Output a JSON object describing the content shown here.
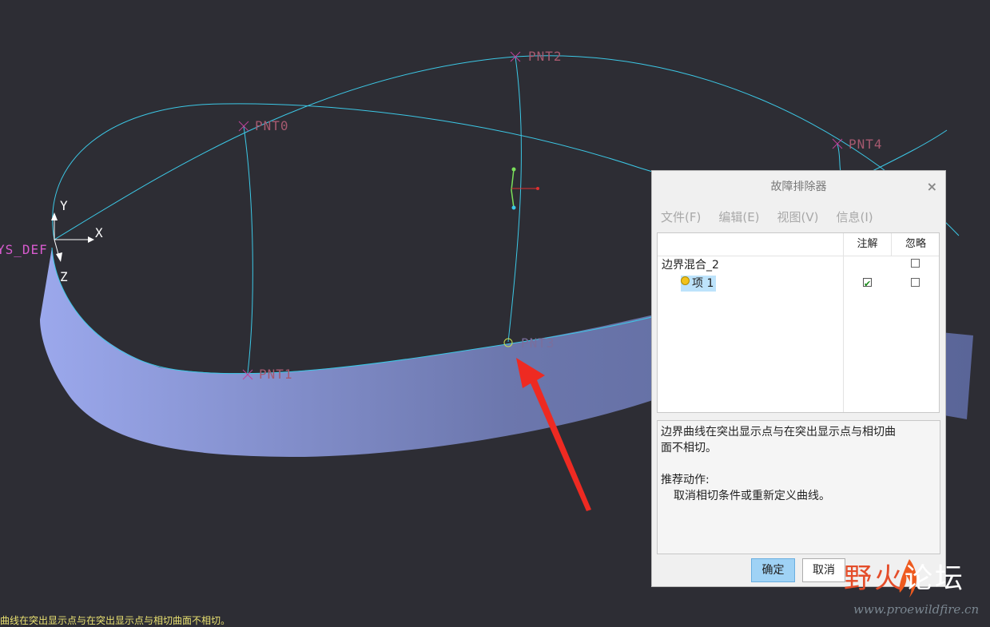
{
  "viewport": {
    "points": [
      "PNT0",
      "PNT1",
      "PNT2",
      "PNT3",
      "PNT4"
    ],
    "csys_label": "YS_DEF",
    "axes": {
      "x": "X",
      "y": "Y",
      "z": "Z"
    },
    "status_message": "曲线在突出显示点与在突出显示点与相切曲面不相切。"
  },
  "dialog": {
    "title": "故障排除器",
    "close": "×",
    "menu": [
      "文件(F)",
      "编辑(E)",
      "视图(V)",
      "信息(I)"
    ],
    "columns": {
      "note": "注解",
      "ignore": "忽略"
    },
    "tree": [
      {
        "label": "边界混合_2",
        "note": null,
        "ignore": false
      },
      {
        "label": "项 1",
        "note": true,
        "ignore": false
      }
    ],
    "message_line1": "边界曲线在突出显示点与在突出显示点与相切曲",
    "message_line2": "面不相切。",
    "recommend_title": "推荐动作:",
    "recommend_text": "取消相切条件或重新定义曲线。",
    "ok": "确定",
    "cancel": "取消"
  },
  "watermark": {
    "part1": "野火",
    "part2": "论坛",
    "url": "www.proewildfire.cn"
  },
  "colors": {
    "background": "#2d2d34",
    "curve": "#3cc8e6",
    "point_marker": "#c0409a",
    "surface_light": "#9aa6e8",
    "surface_dark": "#505a8c",
    "arrow": "#ee2a22",
    "ok_button": "#9fd2f5"
  }
}
